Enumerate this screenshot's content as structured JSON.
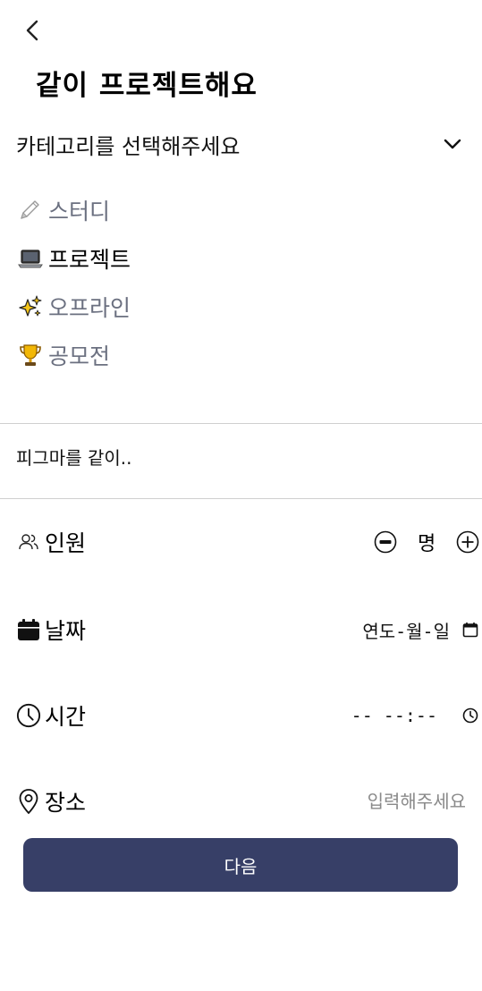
{
  "header": {
    "back_icon": "chevron-left-icon",
    "title": "같이 프로젝트해요"
  },
  "category": {
    "placeholder": "카테고리를 선택해주세요",
    "toggle_icon": "chevron-down-icon",
    "options": [
      {
        "emoji": "pencil-icon",
        "label": "스터디",
        "selected": false
      },
      {
        "emoji": "laptop-icon",
        "label": "프로젝트",
        "selected": true
      },
      {
        "emoji": "sparkles-icon",
        "label": "오프라인",
        "selected": false
      },
      {
        "emoji": "trophy-icon",
        "label": "공모전",
        "selected": false
      }
    ]
  },
  "description": {
    "text": "피그마를 같이.."
  },
  "people": {
    "icon": "users-icon",
    "label": "인원",
    "unit": "명",
    "decrement_icon": "minus-circle-icon",
    "increment_icon": "plus-circle-icon"
  },
  "date": {
    "icon": "calendar-icon",
    "label": "날짜",
    "value": "연도-월-일",
    "picker_icon": "calendar-outline-icon"
  },
  "time": {
    "icon": "clock-icon",
    "label": "시간",
    "value": "-- --:--",
    "picker_icon": "clock-small-icon"
  },
  "place": {
    "icon": "map-pin-icon",
    "label": "장소",
    "placeholder": "입력해주세요"
  },
  "next_button": {
    "label": "다음"
  },
  "colors": {
    "primary": "#373f67",
    "muted_text": "#6b7080",
    "divider": "#cfcfcf"
  }
}
